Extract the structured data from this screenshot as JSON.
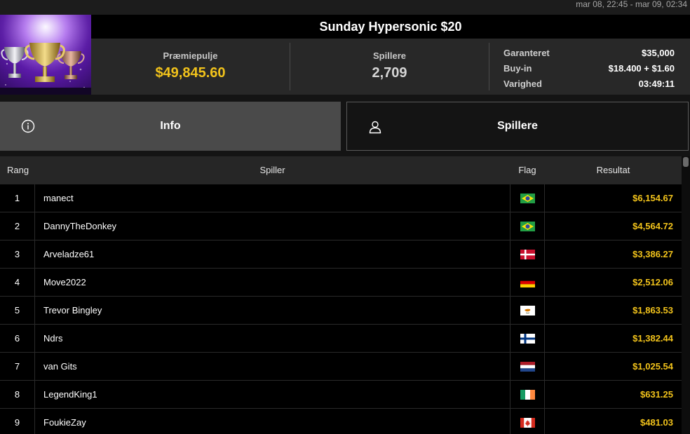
{
  "date_range": "mar 08, 22:45 - mar 09, 02:34",
  "tournament": {
    "title": "Sunday Hypersonic $20",
    "prize_pool_label": "Præmiepulje",
    "prize_pool_value": "$49,845.60",
    "players_label": "Spillere",
    "players_value": "2,709",
    "details": [
      {
        "label": "Garanteret",
        "value": "$35,000"
      },
      {
        "label": "Buy-in",
        "value": "$18.400 + $1.60"
      },
      {
        "label": "Varighed",
        "value": "03:49:11"
      }
    ]
  },
  "tabs": {
    "info_label": "Info",
    "players_label": "Spillere",
    "info_icon": "info-circle-icon",
    "players_icon": "user-icon"
  },
  "table": {
    "columns": {
      "rank": "Rang",
      "player": "Spiller",
      "flag": "Flag",
      "result": "Resultat"
    },
    "rows": [
      {
        "rank": "1",
        "player": "manect",
        "flag": "brazil",
        "result": "$6,154.67"
      },
      {
        "rank": "2",
        "player": "DannyTheDonkey",
        "flag": "brazil",
        "result": "$4,564.72"
      },
      {
        "rank": "3",
        "player": "Arveladze61",
        "flag": "denmark",
        "result": "$3,386.27"
      },
      {
        "rank": "4",
        "player": "Move2022",
        "flag": "germany",
        "result": "$2,512.06"
      },
      {
        "rank": "5",
        "player": "Trevor Bingley",
        "flag": "cyprus",
        "result": "$1,863.53"
      },
      {
        "rank": "6",
        "player": "Ndrs",
        "flag": "finland",
        "result": "$1,382.44"
      },
      {
        "rank": "7",
        "player": "van Gits",
        "flag": "netherlands",
        "result": "$1,025.54"
      },
      {
        "rank": "8",
        "player": "LegendKing1",
        "flag": "ireland",
        "result": "$631.25"
      },
      {
        "rank": "9",
        "player": "FoukieZay",
        "flag": "canada",
        "result": "$481.03"
      }
    ]
  },
  "colors": {
    "accent_gold": "#f2c31b",
    "active_tab": "#4a4a4a"
  }
}
